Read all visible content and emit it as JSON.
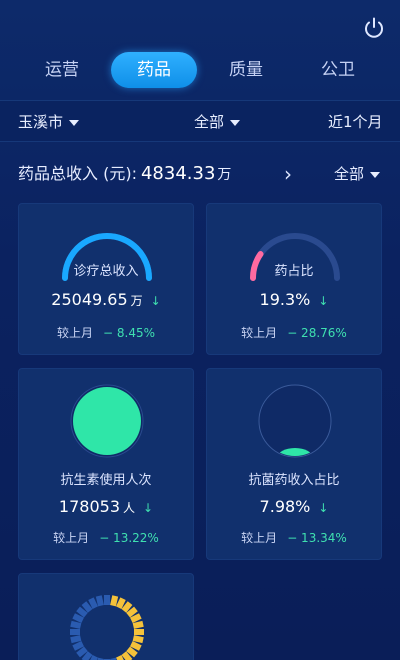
{
  "tabs": [
    {
      "label": "运营",
      "active": false
    },
    {
      "label": "药品",
      "active": true
    },
    {
      "label": "质量",
      "active": false
    },
    {
      "label": "公卫",
      "active": false
    }
  ],
  "filters": {
    "region": "玉溪市",
    "scope": "全部",
    "period": "近1个月"
  },
  "summary": {
    "label": "药品总收入 (元):",
    "value": "4834.33",
    "unit": "万",
    "filter": "全部"
  },
  "cards": [
    {
      "label": "诊疗总收入",
      "value": "25049.65",
      "unit": "万",
      "trend": "↓",
      "compare_label": "较上月",
      "compare_pct": "− 8.45%",
      "gauge_fill": 1.0,
      "gauge_color": "#19a8ff"
    },
    {
      "label": "药占比",
      "value": "19.3%",
      "unit": "",
      "trend": "↓",
      "compare_label": "较上月",
      "compare_pct": "− 28.76%",
      "gauge_fill": 0.193,
      "gauge_color": "#ff6aa0"
    },
    {
      "label": "抗生素使用人次",
      "value": "178053",
      "unit": "人",
      "trend": "↓",
      "compare_label": "较上月",
      "compare_pct": "− 13.22%",
      "gauge_fill": 1.0,
      "gauge_color": "#2fe6a8"
    },
    {
      "label": "抗菌药收入占比",
      "value": "7.98%",
      "unit": "",
      "trend": "↓",
      "compare_label": "较上月",
      "compare_pct": "− 13.34%",
      "gauge_fill": 0.0798,
      "gauge_color": "#2fe6a8"
    }
  ],
  "colors": {
    "accent": "#1fa2ff",
    "positive": "#3fe0b0",
    "ring_yellow": "#f5c23a",
    "ring_blue": "#2a5bb0"
  }
}
